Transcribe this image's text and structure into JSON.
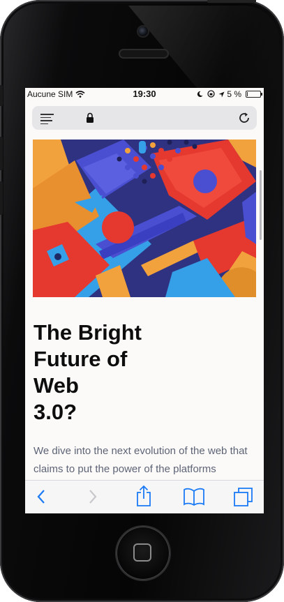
{
  "status_bar": {
    "carrier": "Aucune SIM",
    "time": "19:30",
    "battery_percent": "5 %",
    "battery_level": 0.05
  },
  "browser": {
    "url_bar_icons": [
      "menu-icon",
      "lock-icon",
      "reload-icon"
    ],
    "toolbar_icons": [
      "back-icon",
      "forward-icon",
      "share-icon",
      "bookmarks-icon",
      "tabs-icon"
    ],
    "accent_color": "#1a7af5"
  },
  "article": {
    "title": "The Bright Future of Web 3.0?",
    "intro": "We dive into the next evolution of the web that claims to put the power of the platforms",
    "hero_colors": [
      "#f2a23c",
      "#e5392f",
      "#4a4fd1",
      "#2b2e7a",
      "#35a0e8"
    ]
  },
  "device": {
    "home_button_icon": "home-square-icon"
  }
}
